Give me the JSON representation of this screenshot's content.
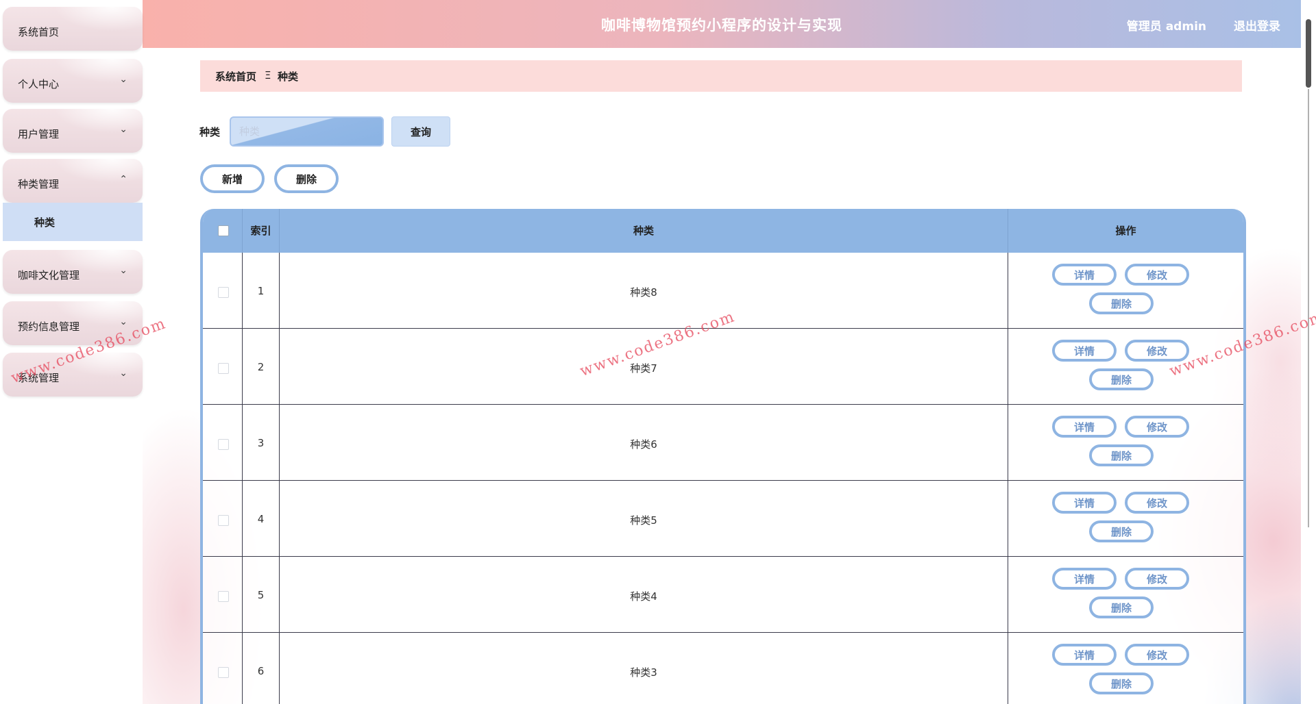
{
  "header": {
    "title": "咖啡博物馆预约小程序的设计与实现",
    "user": "管理员 admin",
    "logout": "退出登录"
  },
  "sidebar": {
    "items": [
      {
        "label": "系统首页",
        "chevron": ""
      },
      {
        "label": "个人中心",
        "chevron": "⌄"
      },
      {
        "label": "用户管理",
        "chevron": "⌄"
      },
      {
        "label": "种类管理",
        "chevron": "⌃"
      },
      {
        "label": "咖啡文化管理",
        "chevron": "⌄"
      },
      {
        "label": "预约信息管理",
        "chevron": "⌄"
      },
      {
        "label": "系统管理",
        "chevron": "⌄"
      }
    ],
    "active_sub": "种类"
  },
  "breadcrumb": {
    "home": "系统首页",
    "separator": "Ξ",
    "current": "种类"
  },
  "search": {
    "label": "种类",
    "placeholder": "种类",
    "button": "查询"
  },
  "actions": {
    "add": "新增",
    "delete": "删除"
  },
  "table": {
    "headers": {
      "index": "索引",
      "type": "种类",
      "ops": "操作"
    },
    "rows": [
      {
        "index": "1",
        "type": "种类8"
      },
      {
        "index": "2",
        "type": "种类7"
      },
      {
        "index": "3",
        "type": "种类6"
      },
      {
        "index": "4",
        "type": "种类5"
      },
      {
        "index": "5",
        "type": "种类4"
      },
      {
        "index": "6",
        "type": "种类3"
      }
    ],
    "op_labels": {
      "detail": "详情",
      "edit": "修改",
      "delete": "删除"
    }
  },
  "watermark": "www.code386.com",
  "colors": {
    "accent_blue": "#8eb5e3",
    "breadcrumb_bg": "#fcdcda",
    "active_menu_bg": "#cfdef5"
  }
}
